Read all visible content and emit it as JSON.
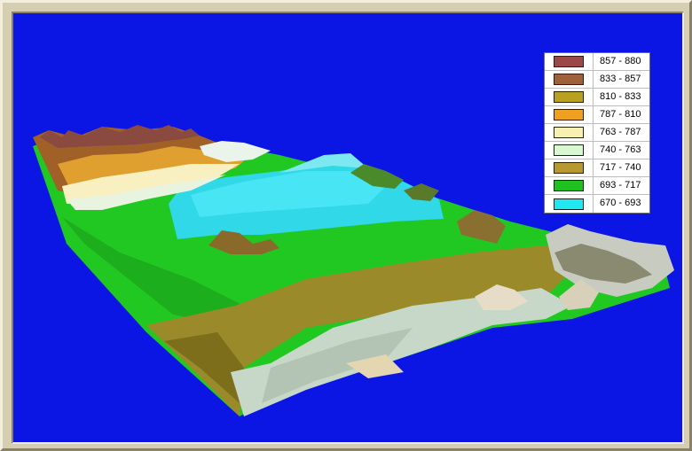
{
  "legend": {
    "entries": [
      {
        "label": "857 - 880",
        "color": "#9a4848"
      },
      {
        "label": "833 - 857",
        "color": "#a0603a"
      },
      {
        "label": "810 - 833",
        "color": "#b8a020"
      },
      {
        "label": "787 - 810",
        "color": "#f0a020"
      },
      {
        "label": "763 - 787",
        "color": "#f8f0b0"
      },
      {
        "label": "740 - 763",
        "color": "#d8f8d0"
      },
      {
        "label": "717 - 740",
        "color": "#b89830"
      },
      {
        "label": "693 - 717",
        "color": "#20c020"
      },
      {
        "label": "670 - 693",
        "color": "#20e8f0"
      }
    ]
  },
  "colors": {
    "background": "#0b16e4",
    "water": "#30d8e8",
    "grass": "#22c822",
    "olive": "#9a8a2a",
    "pale_slope": "#c8d8c8",
    "cliff_brown": "#a06028"
  }
}
